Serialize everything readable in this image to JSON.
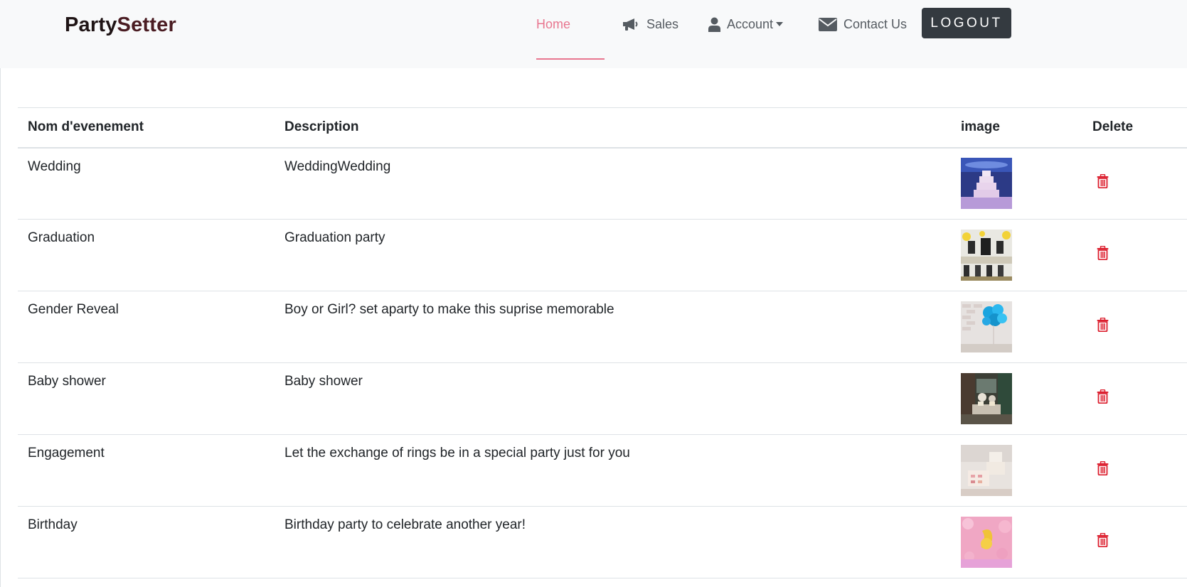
{
  "brand": {
    "part1": "Party",
    "part2": "Setter"
  },
  "nav": {
    "home_label": "Home",
    "sales_label": "Sales",
    "account_label": "Account",
    "contact_label": "Contact Us",
    "logout_label": "Logout"
  },
  "colors": {
    "accent": "#e8768f",
    "navbar_bg": "#f8f9fa",
    "logout_bg": "#343a40",
    "delete": "#dc1f2e"
  },
  "table": {
    "headers": [
      "Nom d'evenement",
      "Description",
      "image",
      "Delete"
    ],
    "rows": [
      {
        "name": "Wedding",
        "description": "WeddingWedding",
        "image": "wedding-cake-photo"
      },
      {
        "name": "Graduation",
        "description": "Graduation party",
        "image": "graduation-party-photo"
      },
      {
        "name": "Gender Reveal",
        "description": "Boy or Girl? set aparty to make this suprise memorable",
        "image": "blue-balloons-photo"
      },
      {
        "name": "Baby shower",
        "description": "Baby shower",
        "image": "baby-shower-table-photo"
      },
      {
        "name": "Engagement",
        "description": "Let the exchange of rings be in a special party just for you",
        "image": "engagement-cake-photo"
      },
      {
        "name": "Birthday",
        "description": "Birthday party to celebrate another year!",
        "image": "birthday-balloon-photo"
      }
    ]
  },
  "icons": {
    "sales": "bullhorn-icon",
    "account": "user-icon",
    "contact": "envelope-icon",
    "delete": "trash-icon"
  }
}
